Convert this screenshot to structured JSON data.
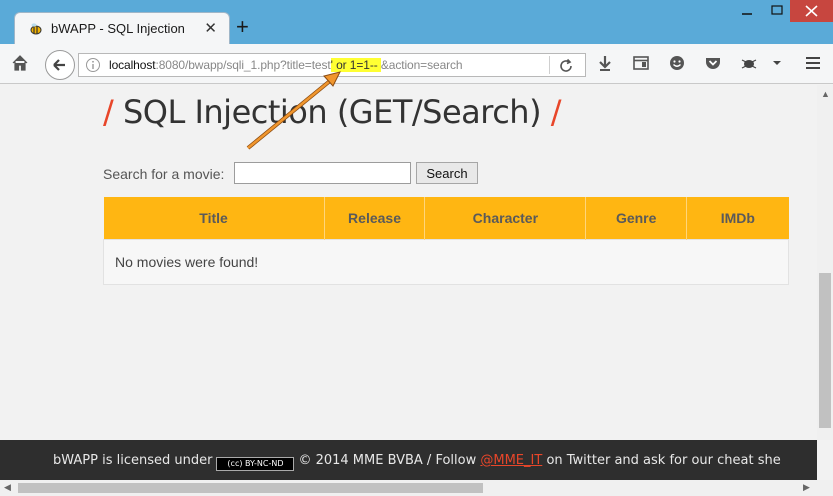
{
  "browser": {
    "tab_title": "bWAPP - SQL Injection",
    "tab_close": "✕",
    "new_tab": "+",
    "url": {
      "host": "localhost",
      "path_pre": ":8080/bwapp/sqli_1.php?title=test",
      "injected": "' or 1=1-- ",
      "path_post": "&action=search"
    },
    "window_close": "✕"
  },
  "page": {
    "title_slash_left": "/",
    "title": " SQL Injection (GET/Search) ",
    "title_slash_right": "/",
    "search_label": "Search for a movie:",
    "search_value": "",
    "search_button": "Search",
    "table": {
      "headers": [
        "Title",
        "Release",
        "Character",
        "Genre",
        "IMDb"
      ],
      "empty_message": "No movies were found!"
    }
  },
  "footer": {
    "text_before": "bWAPP is licensed under",
    "cc_badge": "(cc) BY-NC-ND",
    "text_mid": "© 2014 MME BVBA / Follow",
    "link": "@MME_IT",
    "text_after": "on Twitter and ask for our cheat she"
  },
  "colors": {
    "accent_orange": "#e8462a",
    "table_header": "#ffb612",
    "highlight": "#ffff33",
    "titlebar": "#5aaad8"
  }
}
